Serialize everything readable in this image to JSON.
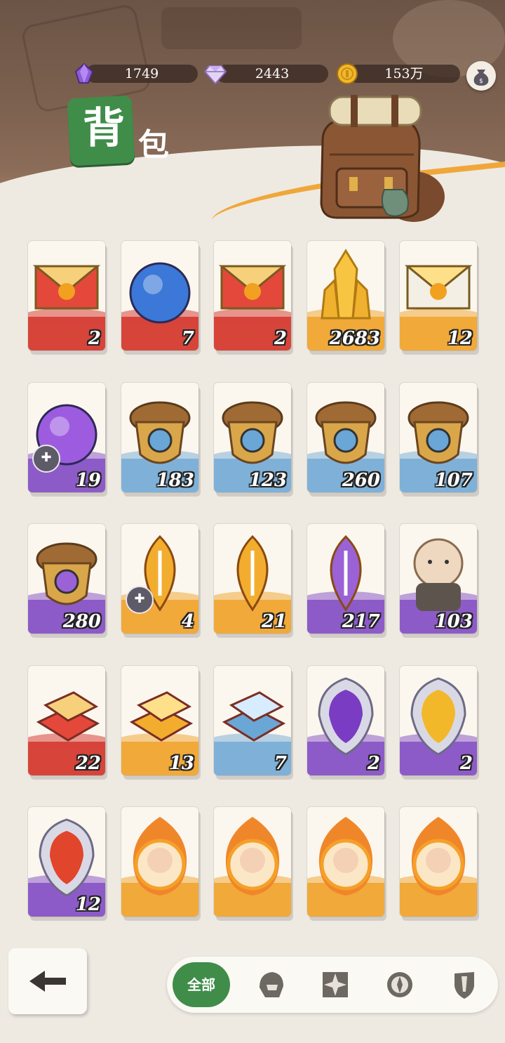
{
  "header": {
    "title_big": "背",
    "title_small": "包",
    "title_dots": "••••••"
  },
  "currencies": [
    {
      "name": "purple-crystal",
      "icon": "purple-crystal-icon",
      "value": "1749"
    },
    {
      "name": "diamond",
      "icon": "diamond-icon",
      "value": "2443"
    },
    {
      "name": "gold-coin",
      "icon": "gold-coin-icon",
      "value": "153万"
    }
  ],
  "items": [
    {
      "icon": "red-envelope-letter-icon",
      "count": "2",
      "band": "red"
    },
    {
      "icon": "blue-orb-icon",
      "count": "7",
      "band": "red"
    },
    {
      "icon": "brown-envelope-letter-icon",
      "count": "2",
      "band": "red"
    },
    {
      "icon": "gold-crystal-icon",
      "count": "2683",
      "band": "gold"
    },
    {
      "icon": "white-envelope-letter-icon",
      "count": "12",
      "band": "gold"
    },
    {
      "icon": "purple-trident-orb-icon",
      "count": "19",
      "band": "purple",
      "puzzle": true
    },
    {
      "icon": "acorn-eye-icon",
      "count": "183",
      "band": "blue"
    },
    {
      "icon": "acorn-target-icon",
      "count": "123",
      "band": "blue"
    },
    {
      "icon": "acorn-leaf-icon",
      "count": "260",
      "band": "blue"
    },
    {
      "icon": "acorn-star-icon",
      "count": "107",
      "band": "blue"
    },
    {
      "icon": "acorn-diamond-icon",
      "count": "280",
      "band": "purple"
    },
    {
      "icon": "orange-seed-icon",
      "count": "4",
      "band": "gold",
      "puzzle": true
    },
    {
      "icon": "orange-seed-icon",
      "count": "21",
      "band": "gold"
    },
    {
      "icon": "blue-seed-icon",
      "count": "217",
      "band": "purple"
    },
    {
      "icon": "hamster-doll-icon",
      "count": "103",
      "band": "purple"
    },
    {
      "icon": "red-ingot-icon",
      "count": "22",
      "band": "red"
    },
    {
      "icon": "gold-ingot-icon",
      "count": "13",
      "band": "gold"
    },
    {
      "icon": "copper-ingot-icon",
      "count": "7",
      "band": "blue"
    },
    {
      "icon": "purple-chain-shield-icon",
      "count": "2",
      "band": "purple"
    },
    {
      "icon": "gold-star-shield-icon",
      "count": "2",
      "band": "purple"
    },
    {
      "icon": "fire-shield-icon",
      "count": "12",
      "band": "purple"
    },
    {
      "icon": "fire-portrait-pink-hair-icon",
      "count": "",
      "band": "gold"
    },
    {
      "icon": "fire-portrait-beast-icon",
      "count": "",
      "band": "gold"
    },
    {
      "icon": "fire-portrait-red-hair-icon",
      "count": "",
      "band": "gold"
    },
    {
      "icon": "fire-portrait-ghost-icon",
      "count": "",
      "band": "gold"
    }
  ],
  "bottom": {
    "back_icon": "back-arrow-icon",
    "tab_all": "全部",
    "tabs": [
      "helmet-icon",
      "compass-star-icon",
      "compass-icon",
      "shield-sword-icon"
    ]
  },
  "colors": {
    "accent_green": "#3f8d49",
    "red": "#d7443a",
    "gold": "#f1a93a",
    "purple": "#8d5bc8",
    "blue": "#7fb1d8"
  }
}
